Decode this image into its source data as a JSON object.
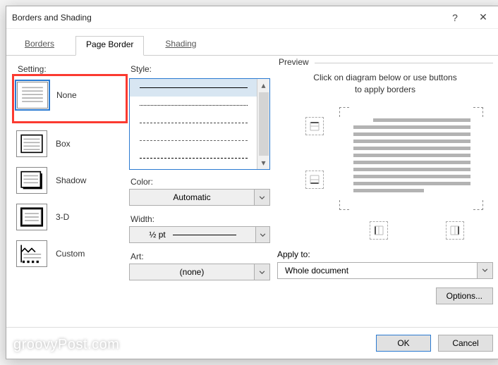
{
  "window": {
    "title": "Borders and Shading"
  },
  "tabs": {
    "borders": "Borders",
    "page_border": "Page Border",
    "shading": "Shading"
  },
  "setting": {
    "label": "Setting:",
    "items": [
      {
        "label": "None"
      },
      {
        "label": "Box"
      },
      {
        "label": "Shadow"
      },
      {
        "label": "3-D"
      },
      {
        "label": "Custom"
      }
    ]
  },
  "style": {
    "label": "Style:",
    "color_label": "Color:",
    "color_value": "Automatic",
    "width_label": "Width:",
    "width_value": "½ pt",
    "art_label": "Art:",
    "art_value": "(none)"
  },
  "preview": {
    "label": "Preview",
    "hint_l1": "Click on diagram below or use buttons",
    "hint_l2": "to apply borders",
    "apply_label": "Apply to:",
    "apply_value": "Whole document",
    "options_label": "Options..."
  },
  "footer": {
    "ok": "OK",
    "cancel": "Cancel"
  },
  "watermark": "groovyPost.com"
}
